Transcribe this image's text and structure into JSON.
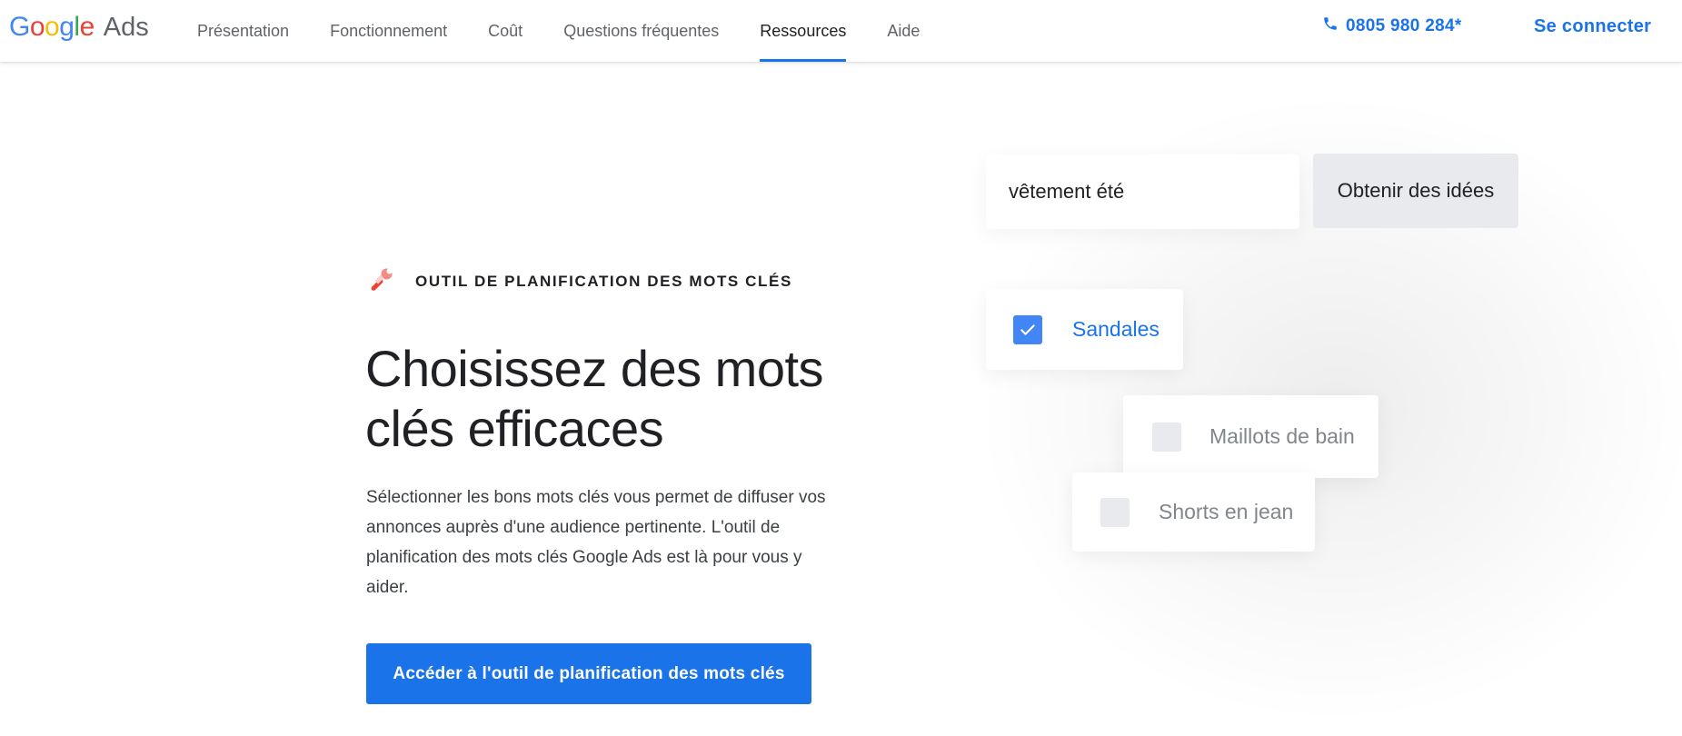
{
  "header": {
    "logo_google": "Google",
    "logo_ads": "Ads",
    "nav": [
      {
        "label": "Présentation",
        "active": false
      },
      {
        "label": "Fonctionnement",
        "active": false
      },
      {
        "label": "Coût",
        "active": false
      },
      {
        "label": "Questions fréquentes",
        "active": false
      },
      {
        "label": "Ressources",
        "active": true
      },
      {
        "label": "Aide",
        "active": false
      }
    ],
    "phone_icon": "phone-icon",
    "phone": "0805 980 284*",
    "signin": "Se connecter"
  },
  "hero": {
    "eyebrow_icon": "wrench-icon",
    "eyebrow": "OUTIL DE PLANIFICATION DES MOTS CLÉS",
    "headline": "Choisissez des mots clés efficaces",
    "body": "Sélectionner les bons mots clés vous permet de diffuser vos annonces auprès d'une audience pertinente. L'outil de planification des mots clés Google Ads est là pour vous y aider.",
    "cta": "Accéder à l'outil de planification des mots clés"
  },
  "illustration": {
    "search_value": "vêtement été",
    "ideas_button": "Obtenir des idées",
    "keywords": [
      {
        "label": "Sandales",
        "checked": true
      },
      {
        "label": "Maillots de bain",
        "checked": false
      },
      {
        "label": "Shorts en jean",
        "checked": false
      }
    ]
  },
  "colors": {
    "accent": "#1a73e8",
    "checkbox_checked": "#4285f4",
    "checkbox_unchecked": "#e8eaed",
    "google_blue": "#4285f4",
    "google_red": "#ea4335",
    "google_yellow": "#fbbc04",
    "google_green": "#34a853"
  }
}
